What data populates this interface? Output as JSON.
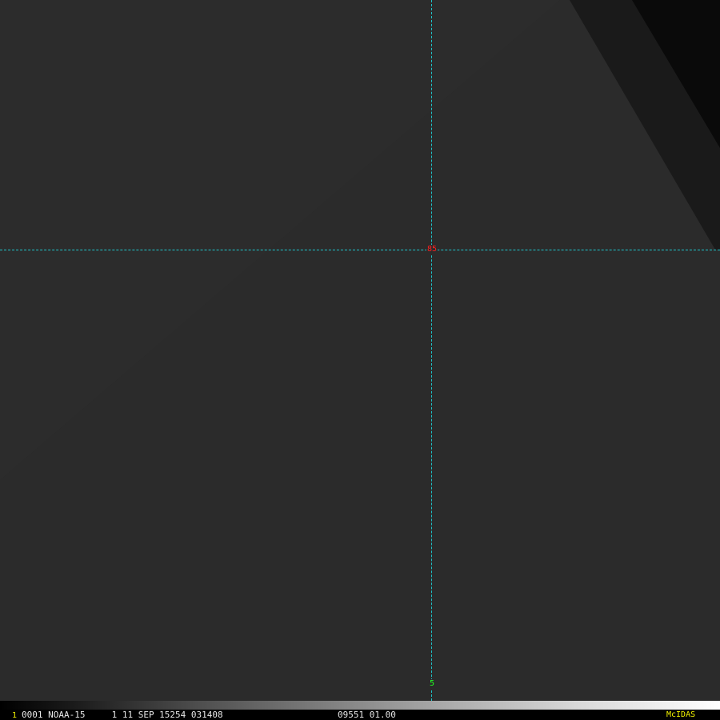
{
  "map": {
    "latitude_label": "85",
    "longitude_label": "5",
    "graticule_color": "#1fc6cc",
    "latitude_label_color": "#ff2020",
    "longitude_label_color": "#22ff22"
  },
  "status_bar": {
    "frame_number": "1",
    "image_info": "0001 NOAA-15     1 11 SEP 15254 031408",
    "image_extra": "09551 01.00",
    "brand": "McIDAS",
    "highlight_color": "#f2f200"
  }
}
